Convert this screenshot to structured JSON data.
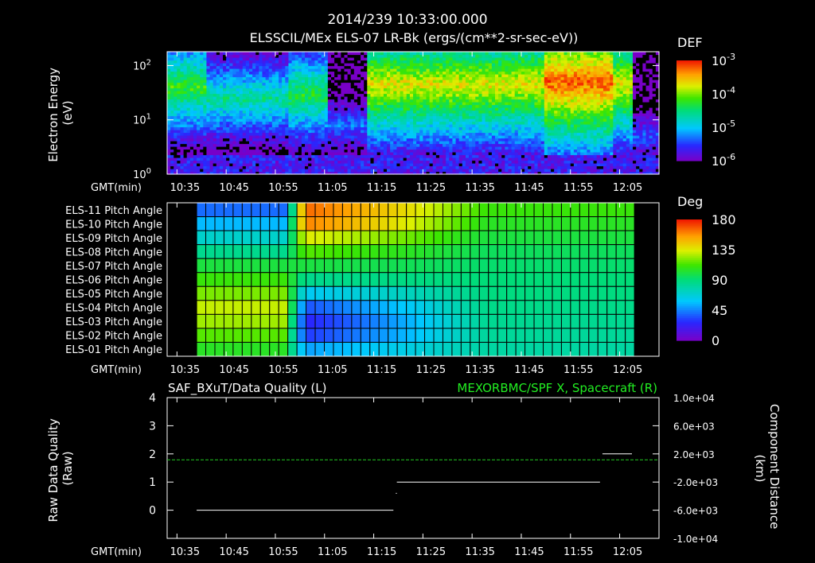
{
  "header": {
    "title": "2014/239 10:33:00.000",
    "subtitle": "ELSSCIL/MEx ELS-07 LR-Bk  (ergs/(cm**2-sr-sec-eV))"
  },
  "time_axis": {
    "label": "GMT(min)",
    "ticks": [
      "10:35",
      "10:45",
      "10:55",
      "11:05",
      "11:15",
      "11:25",
      "11:35",
      "11:45",
      "11:55",
      "12:05"
    ]
  },
  "colors": {
    "quality_series": "#ffffff",
    "distance_series": "#22cc22",
    "distance_title": "#22ee22",
    "grid_line": "#000000"
  },
  "chart_data": [
    {
      "type": "heatmap",
      "name": "spectrogram",
      "title": "ELSSCIL/MEx ELS-07 LR-Bk  (ergs/(cm**2-sr-sec-eV))",
      "ylabel": "Electron Energy\n(eV)",
      "ylabel_lines": [
        "Electron Energy",
        "(eV)"
      ],
      "xlabel": "GMT(min)",
      "xlim_min": [
        0,
        100
      ],
      "y_scale": "log",
      "ylim": [
        1,
        180
      ],
      "y_ticks": [
        {
          "value": 1,
          "base": "10",
          "exp": "0"
        },
        {
          "value": 10,
          "base": "10",
          "exp": "1"
        },
        {
          "value": 100,
          "base": "10",
          "exp": "2"
        }
      ],
      "colorbar": {
        "label": "DEF",
        "scale": "log",
        "range": [
          1e-06,
          0.001
        ],
        "ticks": [
          {
            "value": 0.001,
            "base": "10",
            "exp": "-3"
          },
          {
            "value": 0.0001,
            "base": "10",
            "exp": "-4"
          },
          {
            "value": 1e-05,
            "base": "10",
            "exp": "-5"
          },
          {
            "value": 1e-06,
            "base": "10",
            "exp": "-6"
          }
        ]
      },
      "features": [
        {
          "t": [
            0,
            8
          ],
          "peak_energy_eV": 40,
          "level_log": -4.2
        },
        {
          "t": [
            8,
            25
          ],
          "peak_energy_eV": 25,
          "level_log": -4.6
        },
        {
          "t": [
            25,
            33
          ],
          "peak_energy_eV": 30,
          "level_log": -4.3
        },
        {
          "t": [
            33,
            41
          ],
          "peak_energy_eV": 8,
          "level_log": -5.3
        },
        {
          "t": [
            41,
            95
          ],
          "peak_energy_eV": 45,
          "level_log": -3.7
        },
        {
          "t": [
            77,
            91
          ],
          "peak_energy_eV": 50,
          "level_log": -3.2
        },
        {
          "t": [
            95,
            100
          ],
          "peak_energy_eV": 5,
          "level_log": -5.4
        }
      ]
    },
    {
      "type": "heatmap",
      "name": "pitch_angle",
      "xlabel": "GMT(min)",
      "rows": [
        "ELS-11 Pitch Angle",
        "ELS-10 Pitch Angle",
        "ELS-09 Pitch Angle",
        "ELS-08 Pitch Angle",
        "ELS-07 Pitch Angle",
        "ELS-06 Pitch Angle",
        "ELS-05 Pitch Angle",
        "ELS-04 Pitch Angle",
        "ELS-03 Pitch Angle",
        "ELS-02 Pitch Angle",
        "ELS-01 Pitch Angle"
      ],
      "xlim_min": [
        0,
        100
      ],
      "data_range_min": [
        6,
        95
      ],
      "colorbar": {
        "label": "Deg",
        "range": [
          0,
          180
        ],
        "ticks": [
          "180",
          "135",
          "90",
          "45",
          "0"
        ]
      },
      "pre_boundary_deg": [
        40,
        55,
        70,
        85,
        100,
        110,
        120,
        130,
        125,
        115,
        105
      ],
      "post_boundary_deg": [
        165,
        160,
        135,
        115,
        100,
        85,
        60,
        35,
        25,
        30,
        50
      ],
      "relaxed_deg": [
        110,
        105,
        100,
        95,
        92,
        90,
        88,
        86,
        84,
        82,
        80
      ],
      "boundary_min": 26,
      "relax_min": 50
    },
    {
      "type": "line",
      "name": "quality",
      "title_left": "SAF_BXuT/Data Quality (L)",
      "title_right": "MEXORBMC/SPF X, Spacecraft (R)",
      "ylabel_left": "Raw Data Quality\n(Raw)",
      "ylabel_left_lines": [
        "Raw Data Quality",
        "(Raw)"
      ],
      "ylabel_right": "Component Distance\n(km)",
      "ylabel_right_lines": [
        "Component Distance",
        "(km)"
      ],
      "xlabel": "GMT(min)",
      "ylim_left": [
        -1,
        4
      ],
      "y_ticks_left": [
        "4",
        "3",
        "2",
        "1",
        "0"
      ],
      "y_ticks_left_values": [
        4,
        3,
        2,
        1,
        0
      ],
      "ylim_right": [
        -10000,
        10000
      ],
      "y_ticks_right": [
        "1.0e+04",
        "6.0e+03",
        "2.0e+03",
        "-2.0e+03",
        "-6.0e+03",
        "-1.0e+04"
      ],
      "y_ticks_right_values": [
        10000,
        6000,
        2000,
        -2000,
        -6000,
        -10000
      ],
      "series": [
        {
          "name": "SAF_BXuT/Data Quality",
          "axis": "left",
          "segments": [
            {
              "t": [
                6,
                46
              ],
              "value": 0
            },
            {
              "t": [
                46.5,
                46.7
              ],
              "value": 0.6
            },
            {
              "t": [
                46.7,
                88
              ],
              "value": 1
            },
            {
              "t": [
                88.5,
                94.5
              ],
              "value": 2
            }
          ]
        },
        {
          "name": "MEXORBMC/SPF X, Spacecraft",
          "axis": "right",
          "points": [
            [
              0,
              1150
            ],
            [
              50,
              1150
            ],
            [
              100,
              1150
            ]
          ]
        }
      ]
    }
  ]
}
